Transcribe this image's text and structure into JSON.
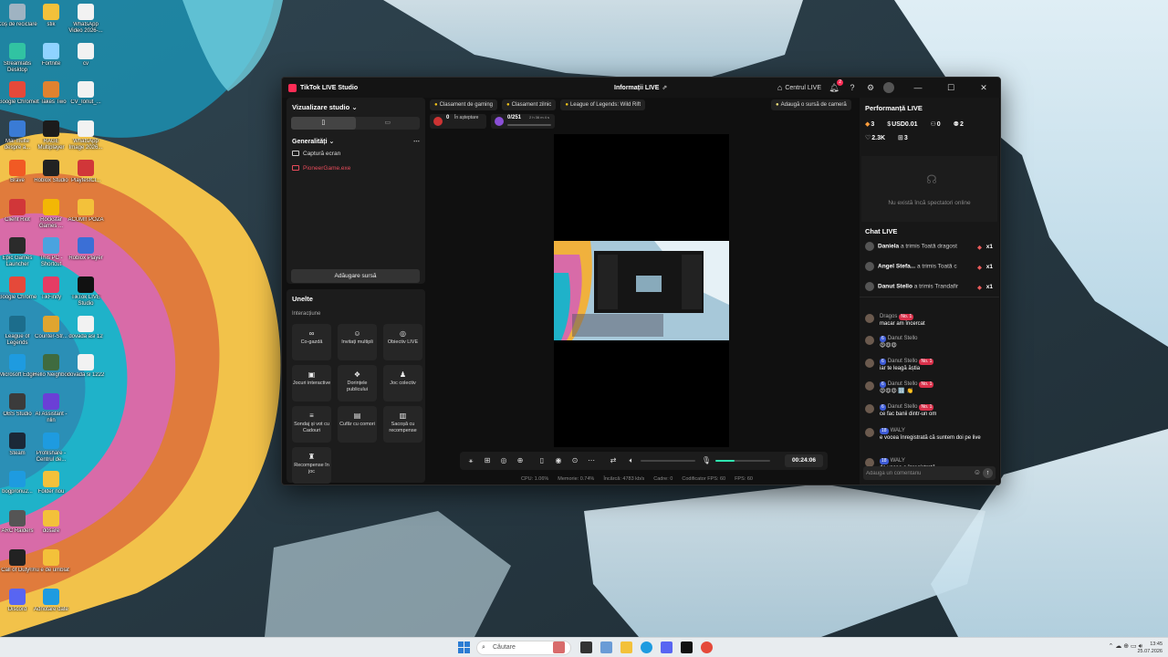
{
  "desktop_icons": [
    {
      "label": "Coș de reciclare",
      "color": "#9fb3c2"
    },
    {
      "label": "Streamlabs Desktop",
      "color": "#31c3a2"
    },
    {
      "label": "Google Chrome",
      "color": "#e5493a"
    },
    {
      "label": "Mai multe despre a...",
      "color": "#3a7bd5"
    },
    {
      "label": "Brave",
      "color": "#f15a24"
    },
    {
      "label": "Client Riot",
      "color": "#d13639"
    },
    {
      "label": "Epic Games Launcher",
      "color": "#2b2b2b"
    },
    {
      "label": "Google Chrome",
      "color": "#e5493a"
    },
    {
      "label": "League of Legends",
      "color": "#1c6d8c"
    },
    {
      "label": "Microsoft Edge",
      "color": "#1e9be0"
    },
    {
      "label": "OBS Studio",
      "color": "#3b3b3b"
    },
    {
      "label": "Steam",
      "color": "#1b2838"
    },
    {
      "label": "bogpronu2...",
      "color": "#1e9be0"
    },
    {
      "label": "ARC Raiders",
      "color": "#555555"
    },
    {
      "label": "Call of Duty®",
      "color": "#222222"
    },
    {
      "label": "Discord",
      "color": "#5865f2"
    },
    {
      "label": "stik",
      "color": "#f3c13a"
    },
    {
      "label": "Fortnite",
      "color": "#8fd3ff"
    },
    {
      "label": "It Takes Two",
      "color": "#e0822f"
    },
    {
      "label": "RAGE Multiplayer",
      "color": "#1c1c1c"
    },
    {
      "label": "Roblox Studio",
      "color": "#222222"
    },
    {
      "label": "Rockstar Games ...",
      "color": "#f2b705"
    },
    {
      "label": "This PC - Shortcut",
      "color": "#4aa3df"
    },
    {
      "label": "TikFinity",
      "color": "#e63c64"
    },
    {
      "label": "Counter-Str...",
      "color": "#e0a52f"
    },
    {
      "label": "Hello Neighbor",
      "color": "#3f6b3f"
    },
    {
      "label": "AI Assistant - nlin",
      "color": "#6b3fd6"
    },
    {
      "label": "Profilshare - Centrul de...",
      "color": "#1e9be0"
    },
    {
      "label": "Folder nou",
      "color": "#f3c13a"
    },
    {
      "label": "dosare",
      "color": "#f3c13a"
    },
    {
      "label": "nu e de umblat",
      "color": "#f3c13a"
    },
    {
      "label": "Adnotare date",
      "color": "#1e9be0"
    },
    {
      "label": "WhatsApp Video 2026-...",
      "color": "#f2f2f2"
    },
    {
      "label": "cv",
      "color": "#f2f2f2"
    },
    {
      "label": "CV_Ionut_...",
      "color": "#f2f2f2"
    },
    {
      "label": "WhatsApp Image 2026...",
      "color": "#f2f2f2"
    },
    {
      "label": "PlaytestCl...",
      "color": "#d13639"
    },
    {
      "label": "ACUM!! POZA",
      "color": "#f3c13a"
    },
    {
      "label": "Roblox Player",
      "color": "#3b6fd6"
    },
    {
      "label": "TikTok LIVE Studio",
      "color": "#111111"
    },
    {
      "label": "dovada asi 12",
      "color": "#f2f2f2"
    },
    {
      "label": "dovada si 1222",
      "color": "#f2f2f2"
    }
  ],
  "window": {
    "app_title": "TikTok LIVE Studio",
    "center_title": "Informații LIVE",
    "live_center": "Centrul LIVE",
    "notif_count": "2"
  },
  "studio": {
    "header": "Vizualizare studio",
    "general": "Generalități",
    "sources": [
      {
        "label": "Captură ecran",
        "error": false
      },
      {
        "label": "PioneerGame.exe",
        "error": true
      }
    ],
    "add_source": "Adăugare sursă"
  },
  "tools": {
    "header": "Unelte",
    "section": "Interacțiune",
    "items": [
      {
        "label": "Co-gazdă",
        "icon": "∞"
      },
      {
        "label": "Invitați multipli",
        "icon": "☺"
      },
      {
        "label": "Obiectiv LIVE",
        "icon": "◎"
      },
      {
        "label": "Jocuri interactive",
        "icon": "▣"
      },
      {
        "label": "Dorințele publicului",
        "icon": "❖"
      },
      {
        "label": "Joc colectiv",
        "icon": "♟"
      },
      {
        "label": "Sondaj și vot cu Cadouri",
        "icon": "≡"
      },
      {
        "label": "Cufăr cu comori",
        "icon": "▤"
      },
      {
        "label": "Sacoșă cu recompense",
        "icon": "▥"
      },
      {
        "label": "Recompense în joc",
        "icon": "♜"
      }
    ]
  },
  "top_pills": [
    "Clasament de gaming",
    "Clasament zilnic",
    "League of Legends: Wild Rift"
  ],
  "add_camera": "Adaugă o sursă de cameră",
  "waiting": {
    "count": "0",
    "label": "În așteptare"
  },
  "goal": {
    "value": "0/251",
    "extra": "2 h 36 m 4 s"
  },
  "timer": "00:24:06",
  "volume_level": 0.35,
  "perf": [
    "CPU: 1.06%",
    "Memorie: 0.74%",
    "Încărcă: 4783 kb/s",
    "Cadre: 0",
    "Codificator FPS: 60",
    "FPS: 60"
  ],
  "performance": {
    "title": "Performanță LIVE",
    "diamonds": "3",
    "usd": "USD0.01",
    "viewers": "0",
    "followers": "2",
    "likes": "2.3K",
    "gifts": "3",
    "no_viewers": "Nu există încă spectatori online"
  },
  "chat": {
    "title": "Chat LIVE",
    "gifts": [
      {
        "user": "Daniela",
        "text": "a trimis Toată dragost",
        "count": "x1"
      },
      {
        "user": "Angel Stefa...",
        "text": "a trimis Toată c",
        "count": "x1"
      },
      {
        "user": "Danut Stello",
        "text": "a trimis Trandafir",
        "count": "x1"
      }
    ],
    "messages": [
      {
        "level": "",
        "user": "Dragos",
        "no1": "No. 1",
        "text": "macar am încercat"
      },
      {
        "level": "6",
        "user": "Danut Stello",
        "no1": "",
        "text": "😍😍😍"
      },
      {
        "level": "6",
        "user": "Danut Stello",
        "no1": "No. 1",
        "text": "iar te leagă ăștia"
      },
      {
        "level": "6",
        "user": "Danut Stello",
        "no1": "No. 1",
        "text": "😍😍😍 🔢 👏"
      },
      {
        "level": "6",
        "user": "Danut Stello",
        "no1": "No. 1",
        "text": "ce fac banii dintr-un om"
      },
      {
        "level": "18",
        "user": "WALY",
        "no1": "",
        "text": "e vocea înregistrată că suntem doi pe live"
      },
      {
        "level": "18",
        "user": "WALY",
        "no1": "",
        "text": "da vocea e înregistrată"
      }
    ],
    "placeholder": "Adaugă un comentariu"
  },
  "taskbar": {
    "search": "Căutare",
    "time": "13:45",
    "date": "25.07.2026"
  }
}
